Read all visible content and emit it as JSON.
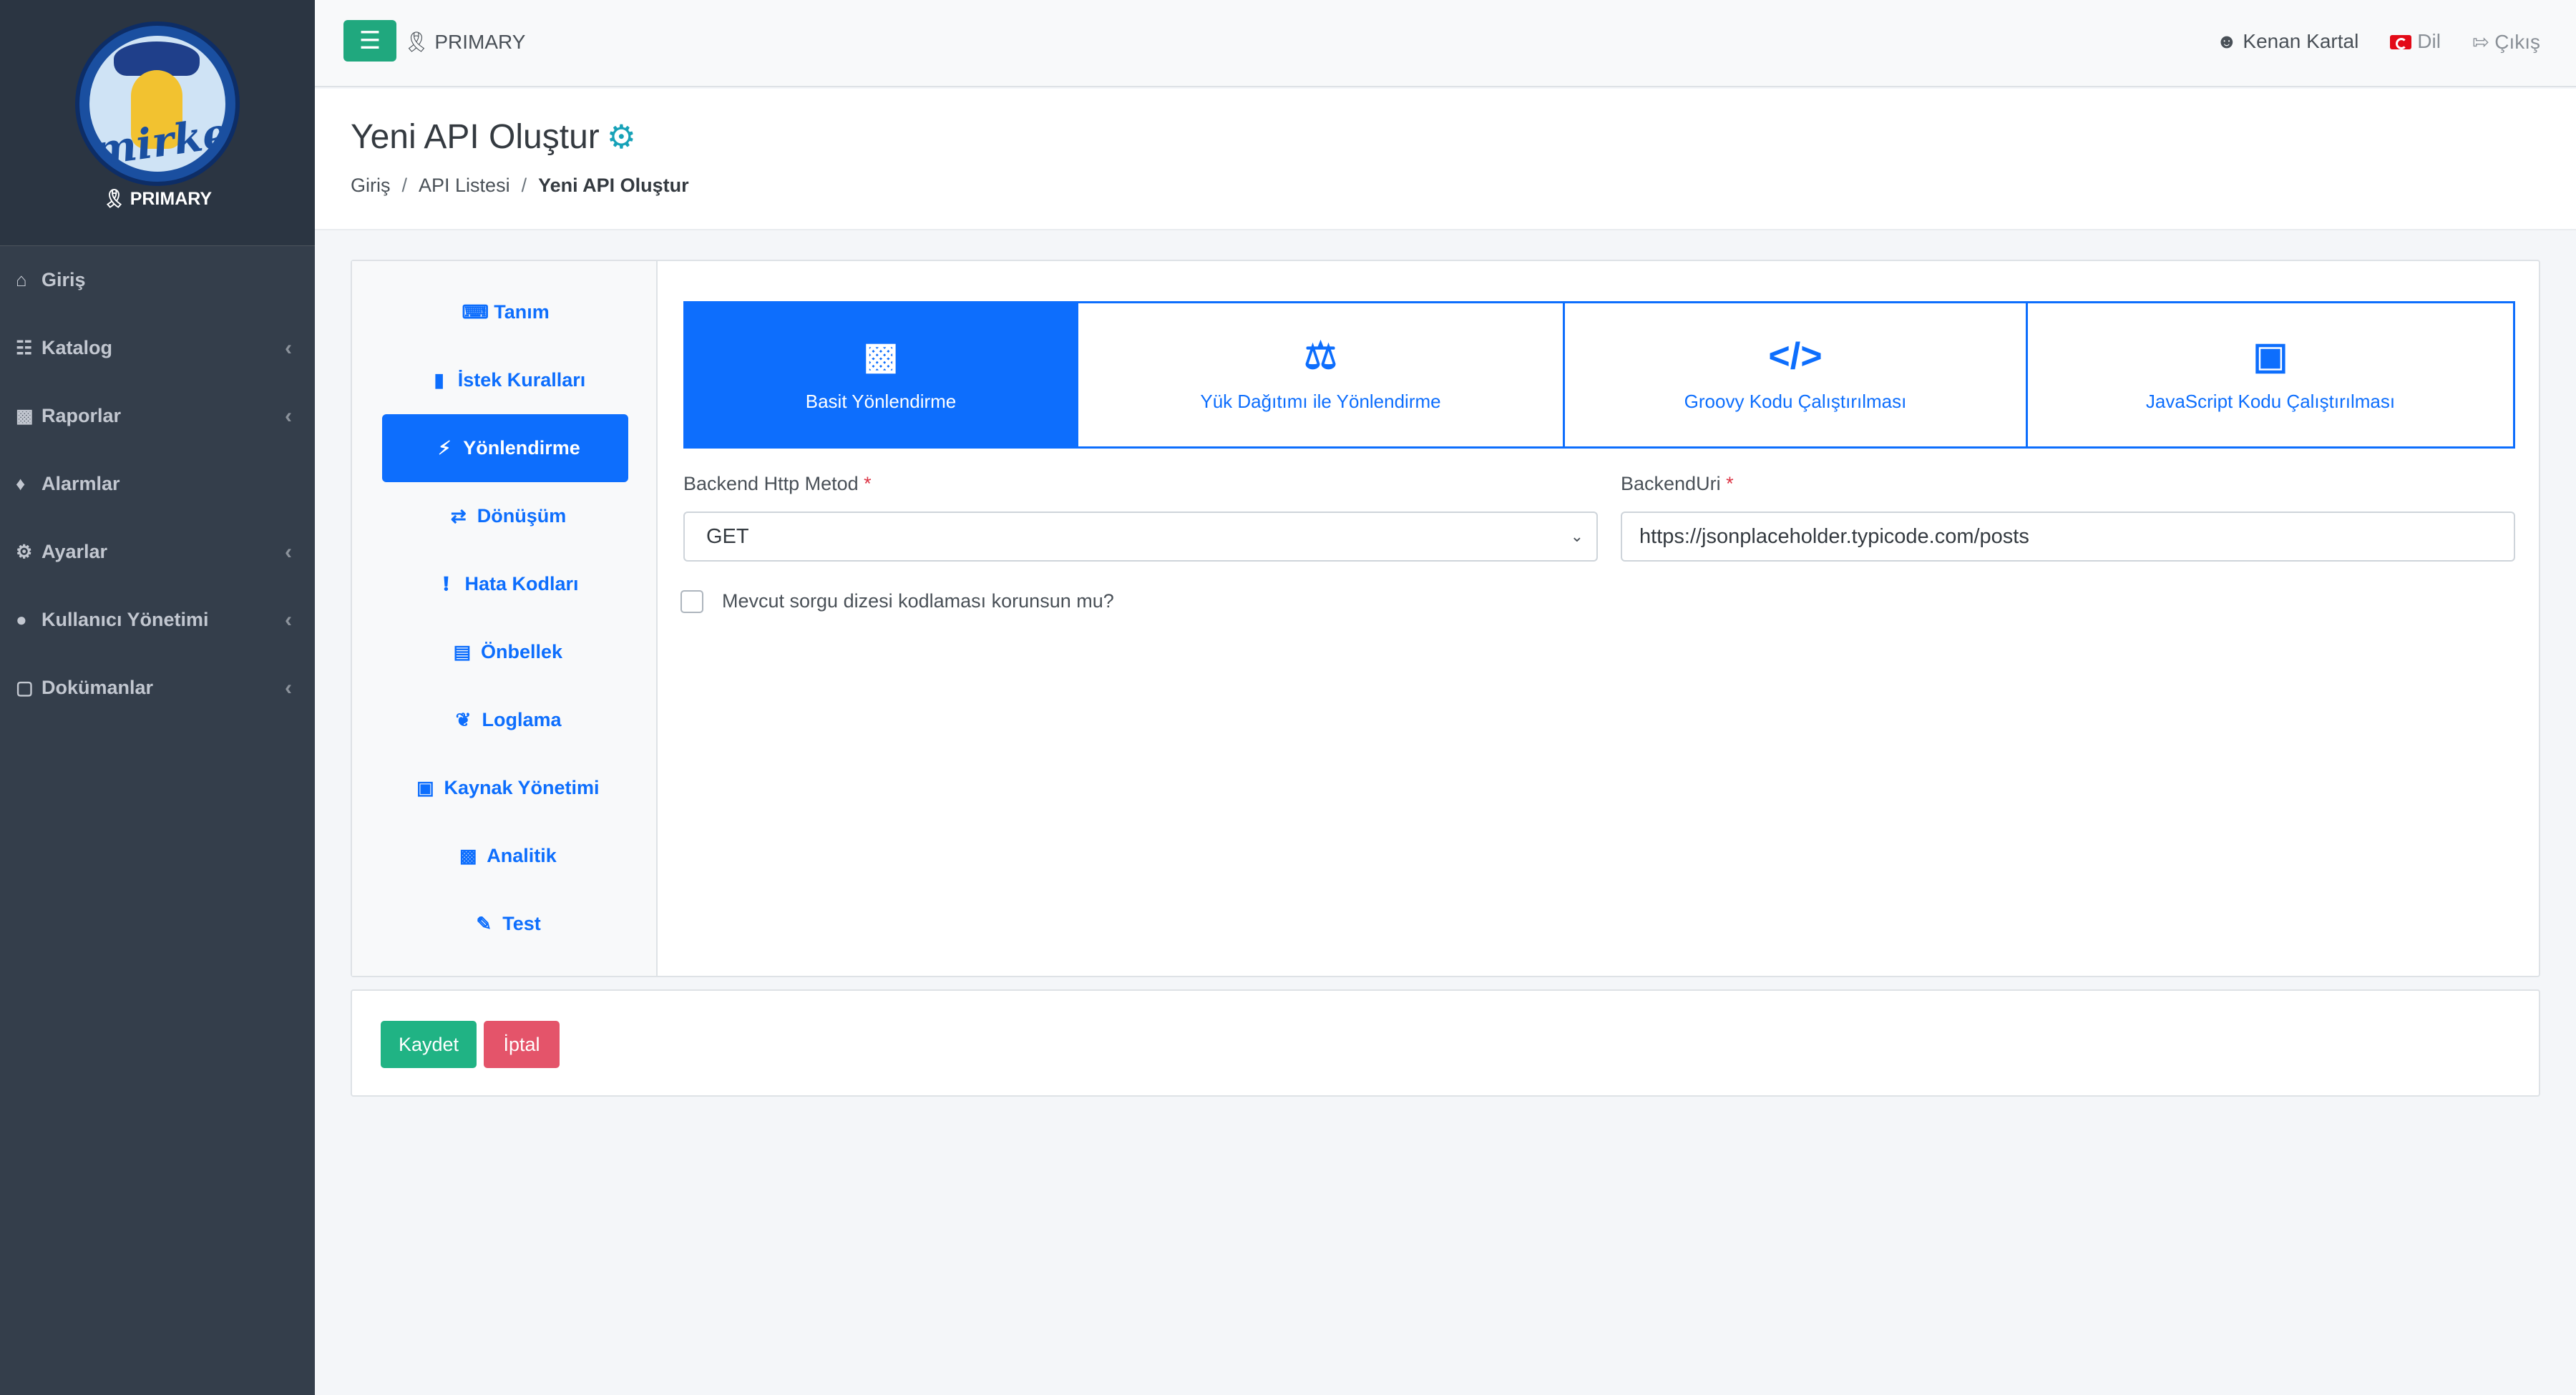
{
  "brand": {
    "logo_text": "mirket",
    "role": "PRIMARY",
    "role_icon": "ribbon-icon"
  },
  "sidebar": {
    "items": [
      {
        "label": "Giriş",
        "icon": "home-icon",
        "has_children": false
      },
      {
        "label": "Katalog",
        "icon": "sitemap-icon",
        "has_children": true
      },
      {
        "label": "Raporlar",
        "icon": "chart-icon",
        "has_children": true
      },
      {
        "label": "Alarmlar",
        "icon": "bell-icon",
        "has_children": false
      },
      {
        "label": "Ayarlar",
        "icon": "cogs-icon",
        "has_children": true
      },
      {
        "label": "Kullanıcı Yönetimi",
        "icon": "users-icon",
        "has_children": true
      },
      {
        "label": "Dokümanlar",
        "icon": "file-icon",
        "has_children": true
      }
    ]
  },
  "topbar": {
    "role": "PRIMARY",
    "user": "Kenan Kartal",
    "language": "Dil",
    "logout": "Çıkış"
  },
  "header": {
    "title": "Yeni API Oluştur",
    "breadcrumb": [
      "Giriş",
      "API Listesi",
      "Yeni API Oluştur"
    ]
  },
  "vtabs": [
    {
      "label": "Tanım",
      "icon": "keyboard-icon",
      "active": false
    },
    {
      "label": "İstek Kuralları",
      "icon": "book-icon",
      "active": false
    },
    {
      "label": "Yönlendirme",
      "icon": "bolt-icon",
      "active": true
    },
    {
      "label": "Dönüşüm",
      "icon": "exchange-icon",
      "active": false
    },
    {
      "label": "Hata Kodları",
      "icon": "exclamation-icon",
      "active": false
    },
    {
      "label": "Önbellek",
      "icon": "memory-icon",
      "active": false
    },
    {
      "label": "Loglama",
      "icon": "leaf-icon",
      "active": false
    },
    {
      "label": "Kaynak Yönetimi",
      "icon": "lock-icon",
      "active": false
    },
    {
      "label": "Analitik",
      "icon": "chart-icon",
      "active": false
    },
    {
      "label": "Test",
      "icon": "pen-icon",
      "active": false
    }
  ],
  "routing": {
    "types": [
      {
        "label": "Basit Yönlendirme",
        "icon": "puzzle-icon",
        "active": true
      },
      {
        "label": "Yük Dağıtımı ile Yönlendirme",
        "icon": "balance-scale-icon",
        "active": false
      },
      {
        "label": "Groovy Kodu Çalıştırılması",
        "icon": "code-icon",
        "active": false
      },
      {
        "label": "JavaScript Kodu Çalıştırılması",
        "icon": "laptop-code-icon",
        "active": false
      }
    ],
    "method_label": "Backend Http Metod",
    "method_value": "GET",
    "uri_label": "BackendUri",
    "uri_value": "https://jsonplaceholder.typicode.com/posts",
    "required_mark": "*",
    "checkbox_label": "Mevcut sorgu dizesi kodlaması korunsun mu?",
    "checkbox_checked": false
  },
  "actions": {
    "save": "Kaydet",
    "cancel": "İptal"
  },
  "colors": {
    "sidebar": "#343e4b",
    "primary": "#0d6efd",
    "success": "#20b384",
    "danger": "#e4546a",
    "accent": "#17a2b8"
  }
}
